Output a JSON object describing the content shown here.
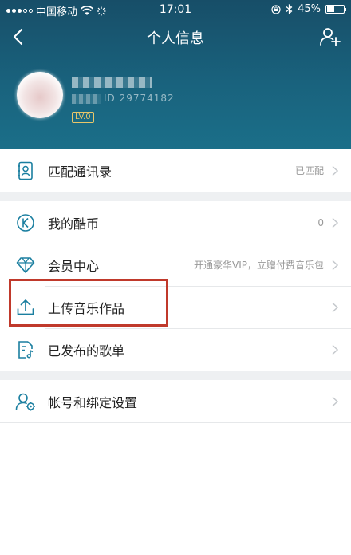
{
  "status_bar": {
    "carrier": "中国移动",
    "time": "17:01",
    "battery": "45%",
    "battery_level": 0.45
  },
  "nav": {
    "title": "个人信息",
    "back_icon": "chevron-left-icon",
    "add_friend_icon": "add-user-icon"
  },
  "profile": {
    "id_prefix": "ID",
    "id_visible": "29774182",
    "level": "LV.0"
  },
  "colors": {
    "header": "#19627d",
    "accent_icon": "#1b7fa0",
    "highlight_border": "#c0392b"
  },
  "groups": [
    {
      "items": [
        {
          "icon": "contacts-icon",
          "label": "匹配通讯录",
          "value": "已匹配"
        }
      ]
    },
    {
      "items": [
        {
          "icon": "kcoin-icon",
          "label": "我的酷币",
          "value": "0"
        },
        {
          "icon": "diamond-icon",
          "label": "会员中心",
          "value": "开通豪华VIP，立赠付费音乐包"
        },
        {
          "icon": "upload-icon",
          "label": "上传音乐作品",
          "value": ""
        },
        {
          "icon": "playlist-icon",
          "label": "已发布的歌单",
          "value": ""
        }
      ]
    },
    {
      "items": [
        {
          "icon": "account-settings-icon",
          "label": "帐号和绑定设置",
          "value": ""
        }
      ]
    }
  ]
}
